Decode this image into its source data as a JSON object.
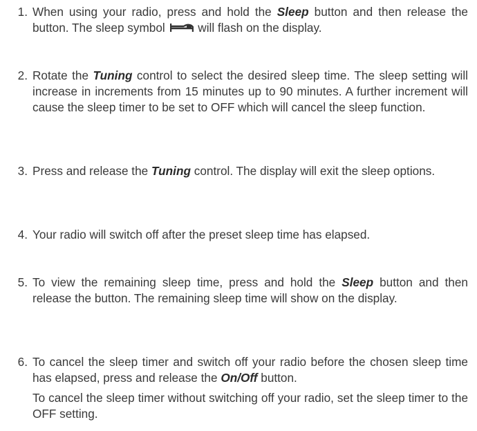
{
  "steps": [
    {
      "number": "1.",
      "before": "When using your radio, press and hold the ",
      "keyword": "Sleep",
      "middle": " button and then release the button. The sleep symbol ",
      "icon": "sleep-bed-icon",
      "after": " will flash on the display."
    },
    {
      "number": "2.",
      "before": "Rotate the ",
      "keyword": "Tuning",
      "after": " control to select the desired sleep time. The sleep setting will increase in increments from 15 minutes up to 90 minutes. A further increment will cause the sleep timer to be set to OFF which will cancel the sleep function."
    },
    {
      "number": "3.",
      "before": "Press and release the ",
      "keyword": "Tuning",
      "after": " control. The display will exit the sleep options."
    },
    {
      "number": "4.",
      "text": "Your radio will switch off after the preset sleep time has elapsed."
    },
    {
      "number": "5.",
      "before": "To view the remaining sleep time, press and hold the ",
      "keyword": "Sleep",
      "after": " button and then release the button. The remaining sleep time will show on the display."
    },
    {
      "number": "6.",
      "before": "To cancel the sleep timer and switch off your radio before the chosen sleep time has elapsed, press and release the ",
      "keyword": "On/Off",
      "after": " button.",
      "extra": "To cancel the sleep timer without switching off your radio, set the sleep timer to the OFF setting."
    }
  ]
}
